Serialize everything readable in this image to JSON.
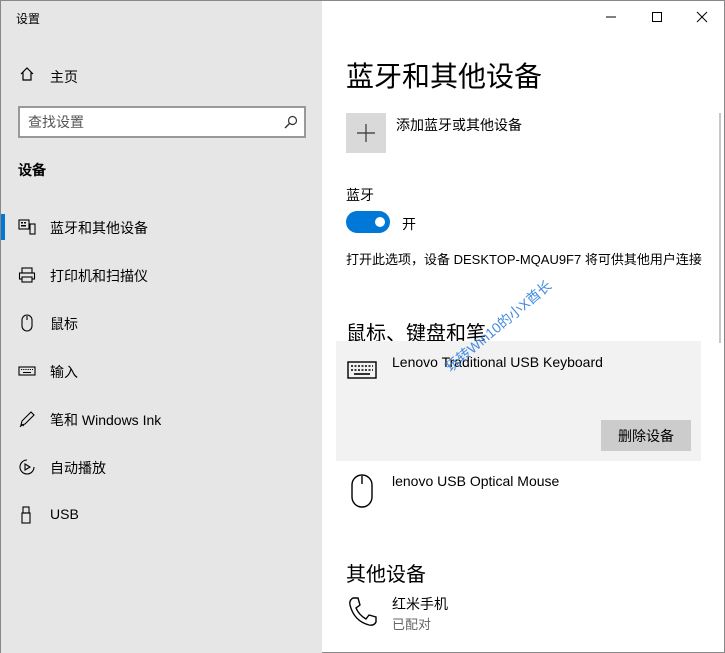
{
  "window": {
    "title": "设置",
    "controls": {
      "minimize": "minimize-icon",
      "maximize": "maximize-icon",
      "close": "close-icon"
    }
  },
  "sidebar": {
    "home_label": "主页",
    "search_placeholder": "查找设置",
    "section_label": "设备",
    "items": [
      {
        "label": "蓝牙和其他设备",
        "icon": "bluetooth-devices-icon",
        "active": true
      },
      {
        "label": "打印机和扫描仪",
        "icon": "printer-icon"
      },
      {
        "label": "鼠标",
        "icon": "mouse-icon"
      },
      {
        "label": "输入",
        "icon": "keyboard-icon"
      },
      {
        "label": "笔和 Windows Ink",
        "icon": "pen-icon"
      },
      {
        "label": "自动播放",
        "icon": "autoplay-icon"
      },
      {
        "label": "USB",
        "icon": "usb-icon"
      }
    ]
  },
  "main": {
    "title": "蓝牙和其他设备",
    "add_device_label": "添加蓝牙或其他设备",
    "bluetooth": {
      "label": "蓝牙",
      "state": "开",
      "discoverable_text": "打开此选项，设备 DESKTOP-MQAU9F7 将可供其他用户连接"
    },
    "mouse_keyboard_pen": {
      "heading": "鼠标、键盘和笔",
      "devices": [
        {
          "name": "Lenovo Traditional USB Keyboard",
          "icon": "keyboard-icon",
          "action": "删除设备"
        },
        {
          "name": "lenovo USB Optical Mouse",
          "icon": "mouse-icon"
        }
      ]
    },
    "other_devices": {
      "heading": "其他设备",
      "devices": [
        {
          "name": "红米手机",
          "status": "已配对",
          "icon": "phone-icon"
        }
      ]
    }
  },
  "watermark": "玩转Win10的小X酋长",
  "colors": {
    "accent": "#0078d7",
    "sidebar_bg": "#e6e6e6",
    "card_bg": "#f2f2f2",
    "button_bg": "#cccccc"
  }
}
